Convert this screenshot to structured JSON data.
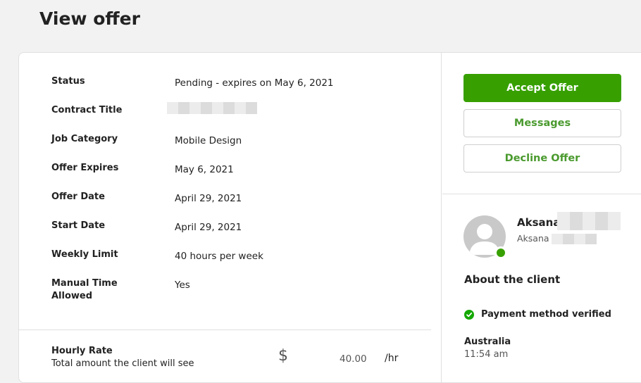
{
  "page": {
    "title": "View offer"
  },
  "details": [
    {
      "label": "Status",
      "value": "Pending - expires on May 6, 2021"
    },
    {
      "label": "Contract Title",
      "value": ""
    },
    {
      "label": "Job Category",
      "value": "Mobile Design"
    },
    {
      "label": "Offer Expires",
      "value": "May 6, 2021"
    },
    {
      "label": "Offer Date",
      "value": "April 29, 2021"
    },
    {
      "label": "Start Date",
      "value": "April 29, 2021"
    },
    {
      "label": "Weekly Limit",
      "value": "40 hours per week"
    },
    {
      "label": "Manual Time Allowed",
      "value": "Yes"
    }
  ],
  "rate": {
    "label": "Hourly Rate",
    "sub": "Total amount the client will see",
    "currency": "$",
    "amount": "40.00",
    "unit": "/hr"
  },
  "actions": {
    "accept": "Accept Offer",
    "messages": "Messages",
    "decline": "Decline Offer"
  },
  "client": {
    "first_name": "Aksana",
    "handle": "Aksana",
    "about_title": "About the client",
    "payment_verified": "Payment method verified",
    "country": "Australia",
    "local_time": "11:54 am"
  },
  "colors": {
    "accent": "#37a000",
    "link_green": "#4a9a2e",
    "verified_green": "#14a800"
  }
}
